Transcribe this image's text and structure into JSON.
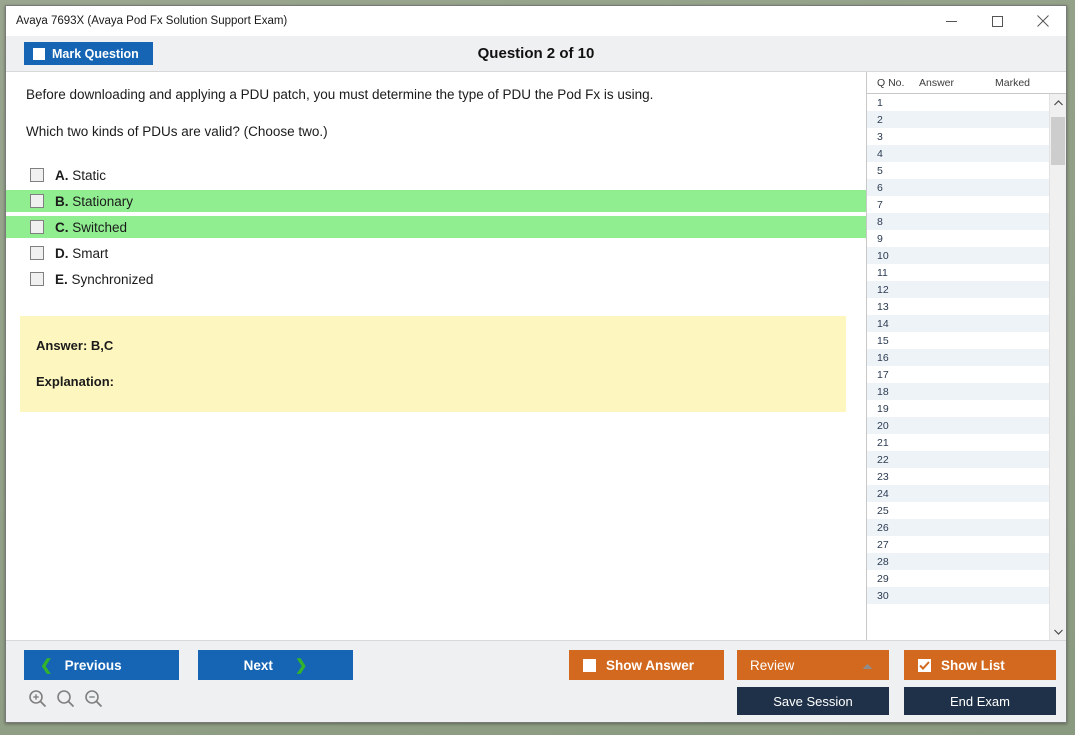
{
  "window": {
    "title": "Avaya 7693X (Avaya Pod Fx Solution Support Exam)",
    "controls": {
      "minimize": "minimize-icon",
      "maximize": "maximize-icon",
      "close": "close-icon"
    }
  },
  "header": {
    "mark_question_label": "Mark Question",
    "mark_question_checked": false,
    "question_counter": "Question 2 of 10"
  },
  "question": {
    "stem": "Before downloading and applying a PDU patch, you must determine the type of PDU the Pod Fx is using.",
    "prompt": "Which two kinds of PDUs are valid? (Choose two.)",
    "options": [
      {
        "letter": "A.",
        "text": "Static",
        "checked": false,
        "correct": false
      },
      {
        "letter": "B.",
        "text": "Stationary",
        "checked": false,
        "correct": true
      },
      {
        "letter": "C.",
        "text": "Switched",
        "checked": false,
        "correct": true
      },
      {
        "letter": "D.",
        "text": "Smart",
        "checked": false,
        "correct": false
      },
      {
        "letter": "E.",
        "text": "Synchronized",
        "checked": false,
        "correct": false
      }
    ]
  },
  "answer_panel": {
    "answer_line": "Answer: B,C",
    "explanation_line": "Explanation:"
  },
  "question_list": {
    "headers": {
      "number": "Q No.",
      "answer": "Answer",
      "marked": "Marked"
    },
    "rows": [
      {
        "number": "1",
        "answer": "",
        "marked": ""
      },
      {
        "number": "2",
        "answer": "",
        "marked": ""
      },
      {
        "number": "3",
        "answer": "",
        "marked": ""
      },
      {
        "number": "4",
        "answer": "",
        "marked": ""
      },
      {
        "number": "5",
        "answer": "",
        "marked": ""
      },
      {
        "number": "6",
        "answer": "",
        "marked": ""
      },
      {
        "number": "7",
        "answer": "",
        "marked": ""
      },
      {
        "number": "8",
        "answer": "",
        "marked": ""
      },
      {
        "number": "9",
        "answer": "",
        "marked": ""
      },
      {
        "number": "10",
        "answer": "",
        "marked": ""
      },
      {
        "number": "11",
        "answer": "",
        "marked": ""
      },
      {
        "number": "12",
        "answer": "",
        "marked": ""
      },
      {
        "number": "13",
        "answer": "",
        "marked": ""
      },
      {
        "number": "14",
        "answer": "",
        "marked": ""
      },
      {
        "number": "15",
        "answer": "",
        "marked": ""
      },
      {
        "number": "16",
        "answer": "",
        "marked": ""
      },
      {
        "number": "17",
        "answer": "",
        "marked": ""
      },
      {
        "number": "18",
        "answer": "",
        "marked": ""
      },
      {
        "number": "19",
        "answer": "",
        "marked": ""
      },
      {
        "number": "20",
        "answer": "",
        "marked": ""
      },
      {
        "number": "21",
        "answer": "",
        "marked": ""
      },
      {
        "number": "22",
        "answer": "",
        "marked": ""
      },
      {
        "number": "23",
        "answer": "",
        "marked": ""
      },
      {
        "number": "24",
        "answer": "",
        "marked": ""
      },
      {
        "number": "25",
        "answer": "",
        "marked": ""
      },
      {
        "number": "26",
        "answer": "",
        "marked": ""
      },
      {
        "number": "27",
        "answer": "",
        "marked": ""
      },
      {
        "number": "28",
        "answer": "",
        "marked": ""
      },
      {
        "number": "29",
        "answer": "",
        "marked": ""
      },
      {
        "number": "30",
        "answer": "",
        "marked": ""
      }
    ],
    "scrollbar": {
      "up_arrow": "chevron-up-icon",
      "down_arrow": "chevron-down-icon"
    }
  },
  "footer": {
    "previous_label": "Previous",
    "next_label": "Next",
    "show_answer_label": "Show Answer",
    "show_answer_checked": false,
    "review_label": "Review",
    "show_list_label": "Show List",
    "show_list_checked": true,
    "save_session_label": "Save Session",
    "end_exam_label": "End Exam",
    "zoom_in": "zoom-in-icon",
    "zoom_reset": "zoom-reset-icon",
    "zoom_out": "zoom-out-icon"
  },
  "colors": {
    "primary_blue": "#1565b4",
    "accent_orange": "#d2691e",
    "navy": "#1f3148",
    "correct_green": "#90ee90",
    "answer_yellow": "#fdf7bf",
    "chevron_green": "#33b22e"
  }
}
